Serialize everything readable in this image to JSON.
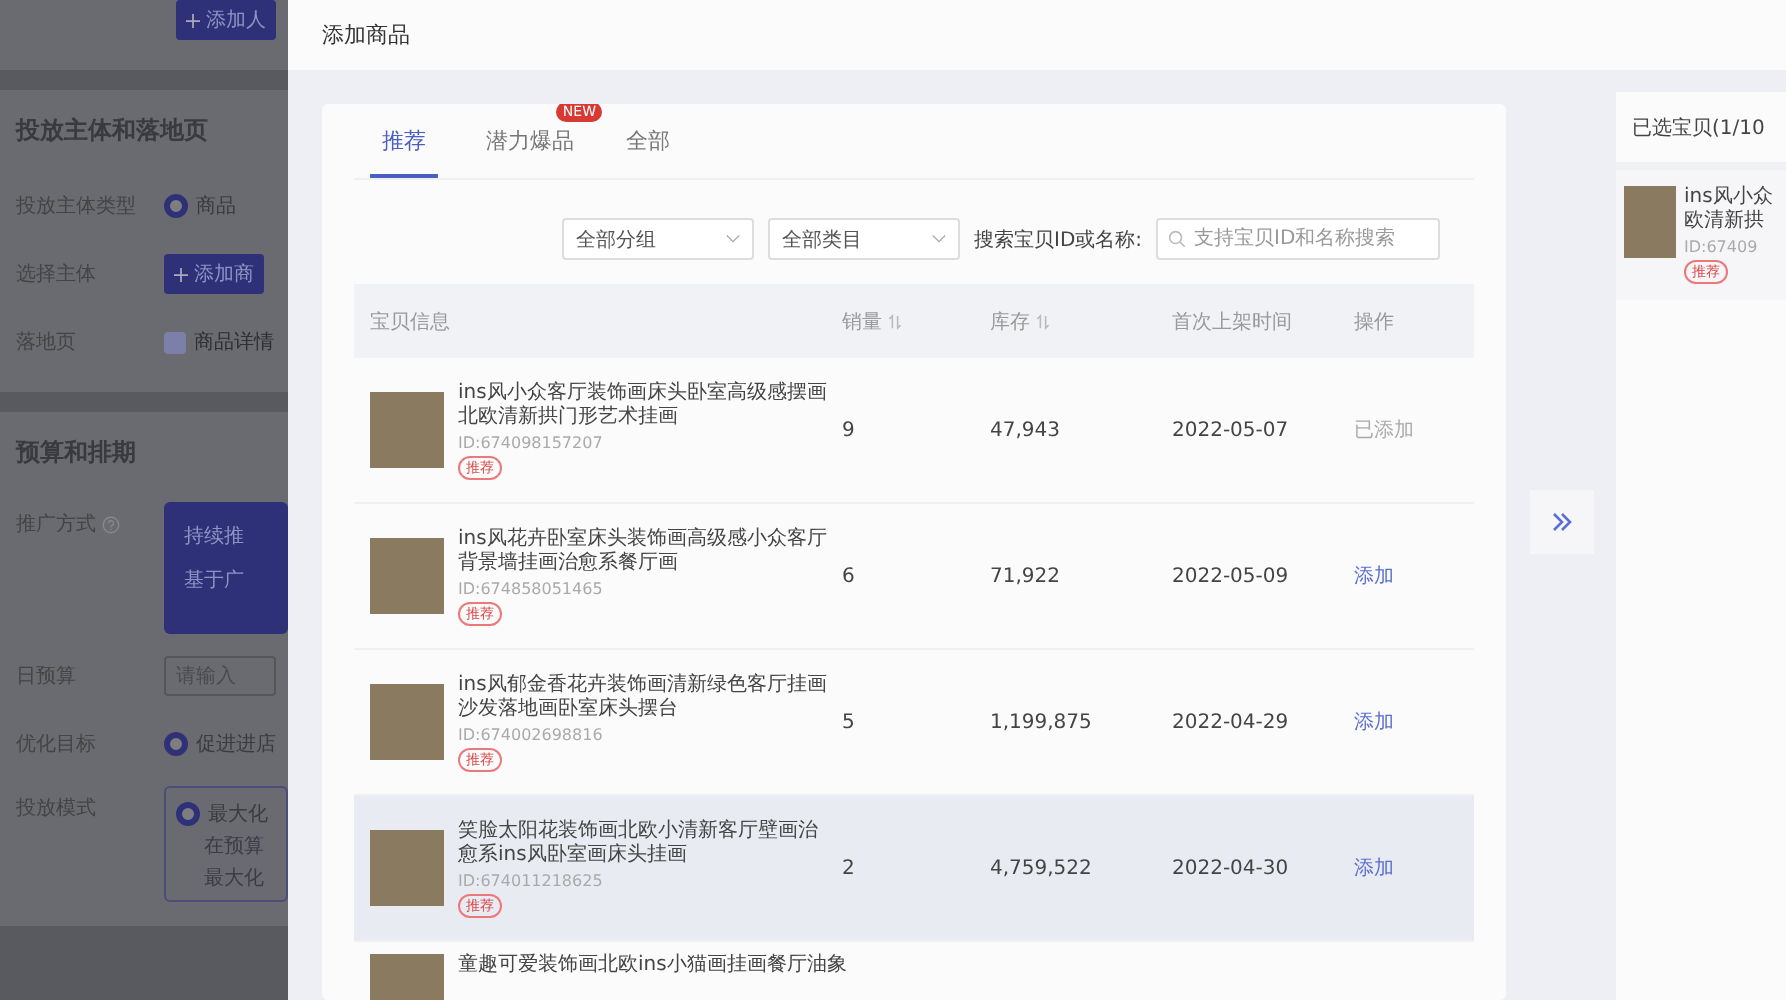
{
  "background_page": {
    "top_button": "添加人",
    "sections": [
      {
        "title": "投放主体和落地页",
        "fields": [
          {
            "kind": "radio",
            "label": "投放主体类型",
            "value": "商品",
            "checked": true
          },
          {
            "kind": "button",
            "label": "选择主体",
            "value": "添加商"
          },
          {
            "kind": "checkbox",
            "label": "落地页",
            "value": "商品详情",
            "checked": true
          }
        ]
      },
      {
        "title": "预算和排期",
        "fields": [
          {
            "kind": "promo",
            "label": "推广方式",
            "value": "持续推",
            "note": "基于广"
          },
          {
            "kind": "input",
            "label": "日预算",
            "placeholder": "请输入"
          },
          {
            "kind": "radio",
            "label": "优化目标",
            "value": "促进进店",
            "checked": true
          },
          {
            "kind": "mode",
            "label": "投放模式",
            "value": "最大化",
            "checked": true,
            "note_lines": [
              "在预算",
              "最大化"
            ]
          }
        ]
      }
    ]
  },
  "modal": {
    "title": "添加商品",
    "tabs": [
      {
        "label": "推荐",
        "selected": true
      },
      {
        "label": "潜力爆品",
        "selected": false,
        "badge": "NEW"
      },
      {
        "label": "全部",
        "selected": false
      }
    ],
    "filters": {
      "group_select": "全部分组",
      "category_select": "全部类目",
      "search_label": "搜索宝贝ID或名称:",
      "search": {
        "placeholder": "支持宝贝ID和名称搜索"
      }
    },
    "table": {
      "columns": [
        {
          "label": "宝贝信息",
          "sortable": false
        },
        {
          "label": "销量",
          "sortable": true
        },
        {
          "label": "库存",
          "sortable": true
        },
        {
          "label": "首次上架时间",
          "sortable": false
        },
        {
          "label": "操作",
          "sortable": false
        }
      ],
      "rows": [
        {
          "title": "ins风小众客厅装饰画床头卧室高级感摆画北欧清新拱门形艺术挂画",
          "id": "ID:674098157207",
          "tag": "推荐",
          "sales": "9",
          "stock": "47,943",
          "date": "2022-05-07",
          "action": "已添加",
          "added": true,
          "highlighted": false
        },
        {
          "title": "ins风花卉卧室床头装饰画高级感小众客厅背景墙挂画治愈系餐厅画",
          "id": "ID:674858051465",
          "tag": "推荐",
          "sales": "6",
          "stock": "71,922",
          "date": "2022-05-09",
          "action": "添加",
          "added": false,
          "highlighted": false
        },
        {
          "title": "ins风郁金香花卉装饰画清新绿色客厅挂画沙发落地画卧室床头摆台",
          "id": "ID:674002698816",
          "tag": "推荐",
          "sales": "5",
          "stock": "1,199,875",
          "date": "2022-04-29",
          "action": "添加",
          "added": false,
          "highlighted": false
        },
        {
          "title": "笑脸太阳花装饰画北欧小清新客厅壁画治愈系ins风卧室画床头挂画",
          "id": "ID:674011218625",
          "tag": "推荐",
          "sales": "2",
          "stock": "4,759,522",
          "date": "2022-04-30",
          "action": "添加",
          "added": false,
          "highlighted": true
        },
        {
          "title": "童趣可爱装饰画北欧ins小猫画挂画餐厅油象"
        }
      ]
    }
  },
  "selected_panel": {
    "title": "已选宝贝(1/10",
    "items": [
      {
        "title_lines": [
          "ins风小众",
          "欧清新拱"
        ],
        "id": "ID:67409",
        "tag": "推荐"
      }
    ]
  }
}
